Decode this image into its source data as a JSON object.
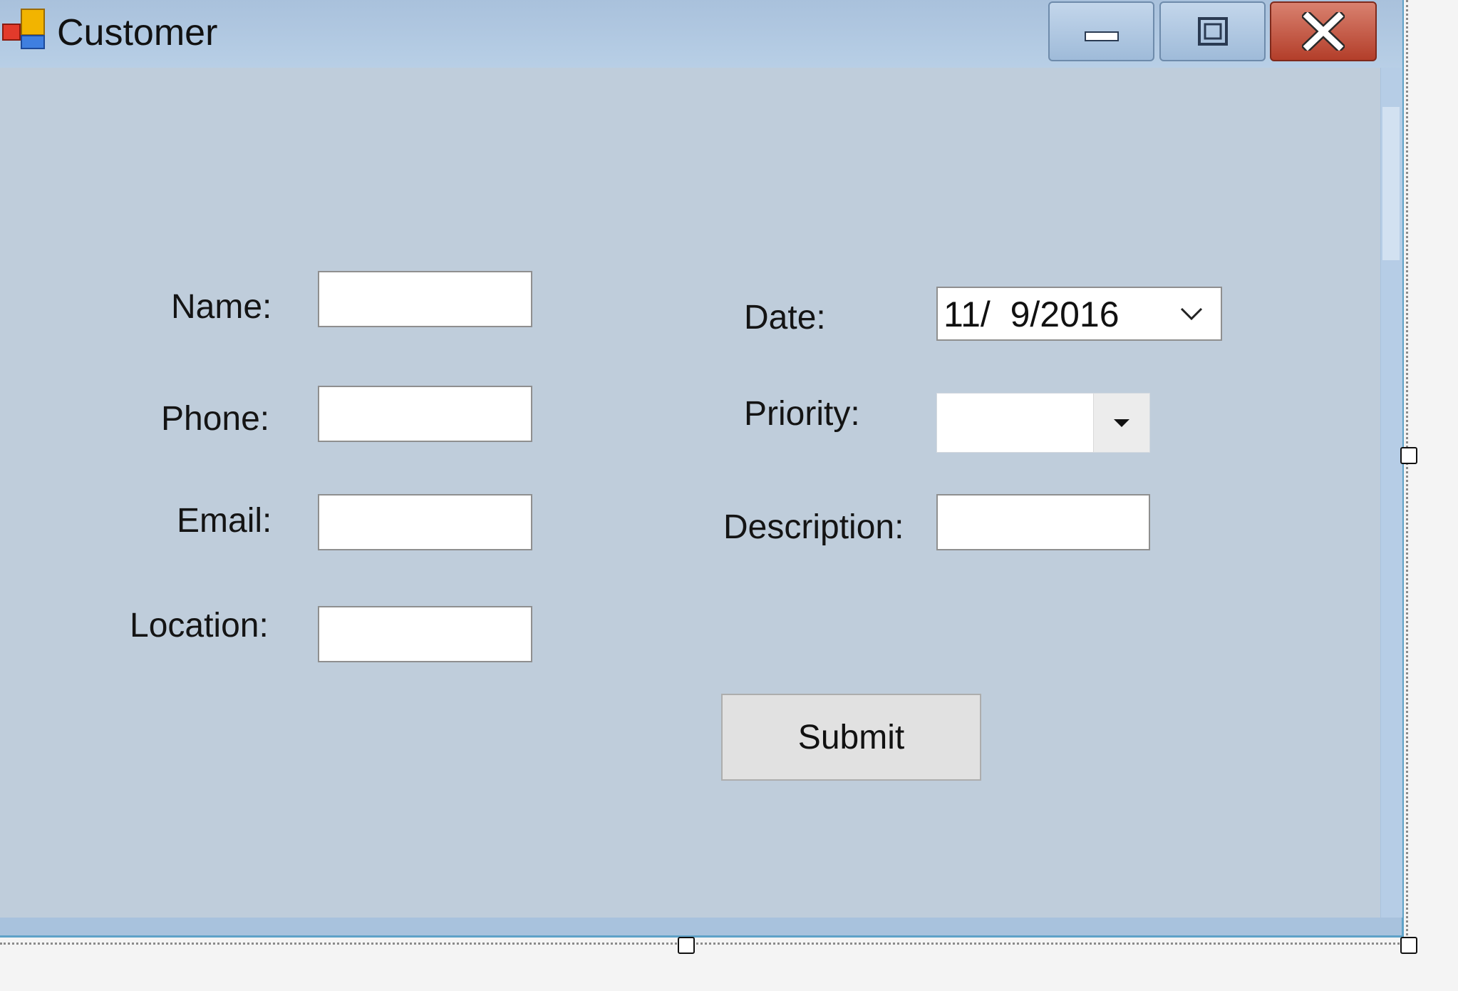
{
  "window": {
    "title": "Customer",
    "icon": "windows-form-icon",
    "caption_buttons": [
      "minimize-icon",
      "maximize-icon",
      "close-icon"
    ]
  },
  "form": {
    "labels": {
      "name": "Name:",
      "phone": "Phone:",
      "email": "Email:",
      "location": "Location:",
      "date": "Date:",
      "priority": "Priority:",
      "description": "Description:"
    },
    "fields": {
      "name": "",
      "phone": "",
      "email": "",
      "location": "",
      "description": "",
      "date": "11/  9/2016",
      "priority": ""
    },
    "submit_label": "Submit"
  },
  "colors": {
    "client_background": "#bfcddb",
    "title_bar": "#b0c7e0",
    "close_button": "#c4503b"
  }
}
